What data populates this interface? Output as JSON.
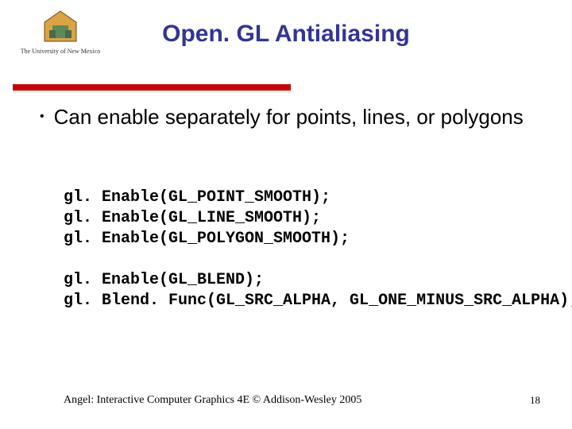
{
  "logo": {
    "institution": "The University of New Mexico"
  },
  "title": "Open. GL Antialiasing",
  "bullet": "Can enable separately for points, lines, or polygons",
  "code1": "gl. Enable(GL_POINT_SMOOTH);\ngl. Enable(GL_LINE_SMOOTH);\ngl. Enable(GL_POLYGON_SMOOTH);",
  "code2": "gl. Enable(GL_BLEND);\ngl. Blend. Func(GL_SRC_ALPHA, GL_ONE_MINUS_SRC_ALPHA);",
  "footer": {
    "left": "Angel: Interactive Computer Graphics 4E © Addison-Wesley 2005",
    "page": "18"
  }
}
